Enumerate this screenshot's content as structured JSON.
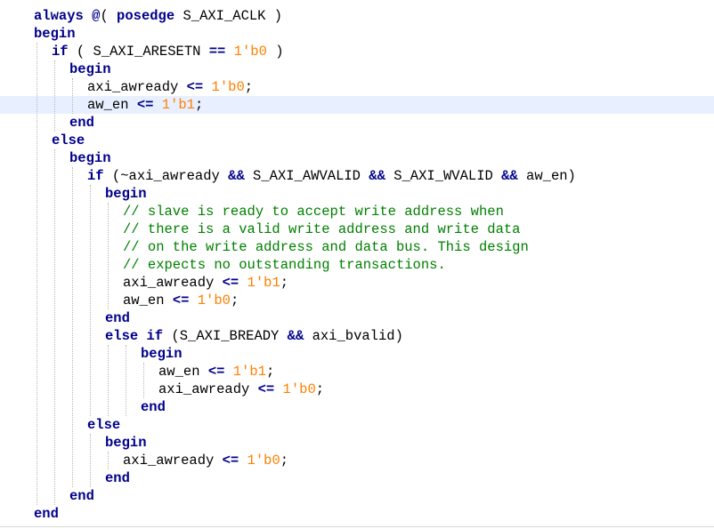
{
  "editor": {
    "language": "verilog",
    "colors": {
      "keyword": "#00008b",
      "number": "#ff8000",
      "comment": "#008000",
      "text": "#000000",
      "current_line": "#e8f0ff"
    },
    "lines": [
      {
        "indent": 0,
        "tokens": [
          {
            "t": "always",
            "k": "kw"
          },
          {
            "t": " "
          },
          {
            "t": "@",
            "k": "op"
          },
          {
            "t": "( "
          },
          {
            "t": "posedge",
            "k": "kw"
          },
          {
            "t": " S_AXI_ACLK )"
          }
        ]
      },
      {
        "indent": 0,
        "tokens": [
          {
            "t": "begin",
            "k": "kw"
          }
        ]
      },
      {
        "indent": 1,
        "tokens": [
          {
            "t": "if",
            "k": "kw"
          },
          {
            "t": " ( S_AXI_ARESETN "
          },
          {
            "t": "==",
            "k": "op"
          },
          {
            "t": " "
          },
          {
            "t": "1'b0",
            "k": "num"
          },
          {
            "t": " )"
          }
        ]
      },
      {
        "indent": 2,
        "tokens": [
          {
            "t": "begin",
            "k": "kw"
          }
        ]
      },
      {
        "indent": 3,
        "tokens": [
          {
            "t": "axi_awready "
          },
          {
            "t": "<=",
            "k": "op"
          },
          {
            "t": " "
          },
          {
            "t": "1'b0",
            "k": "num"
          },
          {
            "t": ";"
          }
        ]
      },
      {
        "indent": 3,
        "current": true,
        "tokens": [
          {
            "t": "aw_en "
          },
          {
            "t": "<=",
            "k": "op"
          },
          {
            "t": " "
          },
          {
            "t": "1'b1",
            "k": "num"
          },
          {
            "t": ";"
          }
        ]
      },
      {
        "indent": 2,
        "tokens": [
          {
            "t": "end",
            "k": "kw"
          }
        ]
      },
      {
        "indent": 1,
        "tokens": [
          {
            "t": "else",
            "k": "kw"
          }
        ]
      },
      {
        "indent": 2,
        "tokens": [
          {
            "t": "begin",
            "k": "kw"
          }
        ]
      },
      {
        "indent": 3,
        "tokens": [
          {
            "t": "if",
            "k": "kw"
          },
          {
            "t": " (~axi_awready "
          },
          {
            "t": "&&",
            "k": "op"
          },
          {
            "t": " S_AXI_AWVALID "
          },
          {
            "t": "&&",
            "k": "op"
          },
          {
            "t": " S_AXI_WVALID "
          },
          {
            "t": "&&",
            "k": "op"
          },
          {
            "t": " aw_en)"
          }
        ]
      },
      {
        "indent": 4,
        "tokens": [
          {
            "t": "begin",
            "k": "kw"
          }
        ]
      },
      {
        "indent": 5,
        "tokens": [
          {
            "t": "// slave is ready to accept write address when",
            "k": "cmt"
          }
        ]
      },
      {
        "indent": 5,
        "tokens": [
          {
            "t": "// there is a valid write address and write data",
            "k": "cmt"
          }
        ]
      },
      {
        "indent": 5,
        "tokens": [
          {
            "t": "// on the write address and data bus. This design",
            "k": "cmt"
          }
        ]
      },
      {
        "indent": 5,
        "tokens": [
          {
            "t": "// expects no outstanding transactions.",
            "k": "cmt"
          }
        ]
      },
      {
        "indent": 5,
        "tokens": [
          {
            "t": "axi_awready "
          },
          {
            "t": "<=",
            "k": "op"
          },
          {
            "t": " "
          },
          {
            "t": "1'b1",
            "k": "num"
          },
          {
            "t": ";"
          }
        ]
      },
      {
        "indent": 5,
        "tokens": [
          {
            "t": "aw_en "
          },
          {
            "t": "<=",
            "k": "op"
          },
          {
            "t": " "
          },
          {
            "t": "1'b0",
            "k": "num"
          },
          {
            "t": ";"
          }
        ]
      },
      {
        "indent": 4,
        "tokens": [
          {
            "t": "end",
            "k": "kw"
          }
        ]
      },
      {
        "indent": 4,
        "tokens": [
          {
            "t": "else if",
            "k": "kw"
          },
          {
            "t": " (S_AXI_BREADY "
          },
          {
            "t": "&&",
            "k": "op"
          },
          {
            "t": " axi_bvalid)"
          }
        ]
      },
      {
        "indent": 6,
        "tokens": [
          {
            "t": "begin",
            "k": "kw"
          }
        ]
      },
      {
        "indent": 7,
        "tokens": [
          {
            "t": "aw_en "
          },
          {
            "t": "<=",
            "k": "op"
          },
          {
            "t": " "
          },
          {
            "t": "1'b1",
            "k": "num"
          },
          {
            "t": ";"
          }
        ]
      },
      {
        "indent": 7,
        "tokens": [
          {
            "t": "axi_awready "
          },
          {
            "t": "<=",
            "k": "op"
          },
          {
            "t": " "
          },
          {
            "t": "1'b0",
            "k": "num"
          },
          {
            "t": ";"
          }
        ]
      },
      {
        "indent": 6,
        "tokens": [
          {
            "t": "end",
            "k": "kw"
          }
        ]
      },
      {
        "indent": 3,
        "tokens": [
          {
            "t": "else",
            "k": "kw"
          }
        ]
      },
      {
        "indent": 4,
        "tokens": [
          {
            "t": "begin",
            "k": "kw"
          }
        ]
      },
      {
        "indent": 5,
        "tokens": [
          {
            "t": "axi_awready "
          },
          {
            "t": "<=",
            "k": "op"
          },
          {
            "t": " "
          },
          {
            "t": "1'b0",
            "k": "num"
          },
          {
            "t": ";"
          }
        ]
      },
      {
        "indent": 4,
        "tokens": [
          {
            "t": "end",
            "k": "kw"
          }
        ]
      },
      {
        "indent": 2,
        "tokens": [
          {
            "t": "end",
            "k": "kw"
          }
        ]
      },
      {
        "indent": 0,
        "tokens": [
          {
            "t": "end",
            "k": "kw"
          }
        ]
      }
    ]
  }
}
